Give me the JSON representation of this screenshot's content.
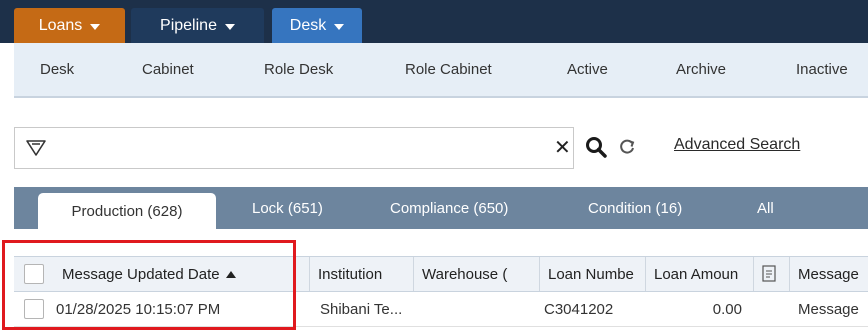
{
  "topnav": {
    "tabs": [
      {
        "label": "Loans",
        "color": "#c56a15"
      },
      {
        "label": "Pipeline",
        "color": "#1f3a5c"
      },
      {
        "label": "Desk",
        "color": "#3675bf"
      }
    ]
  },
  "subnav": {
    "items": [
      "Desk",
      "Cabinet",
      "Role Desk",
      "Role Cabinet",
      "Active",
      "Archive",
      "Inactive"
    ]
  },
  "search": {
    "value": "",
    "advanced_label": "Advanced Search"
  },
  "view_tabs": [
    "Production (628)",
    "Lock (651)",
    "Compliance (650)",
    "Condition (16)",
    "All"
  ],
  "grid": {
    "columns": [
      "Message Updated Date",
      "Institution",
      "Warehouse (",
      "Loan Numbe",
      "Loan Amoun",
      "",
      "Message"
    ],
    "rows": [
      {
        "date": "01/28/2025 10:15:07 PM",
        "institution": "Shibani Te...",
        "warehouse": "",
        "loan_number": "C3041202",
        "loan_amount": "0.00",
        "message": "Message"
      }
    ]
  },
  "colors": {
    "topnav_bg": "#1d3049",
    "subnav_bg": "#e6eef6",
    "viewtabs_bg": "#6d859e",
    "highlight": "#e0191e"
  }
}
